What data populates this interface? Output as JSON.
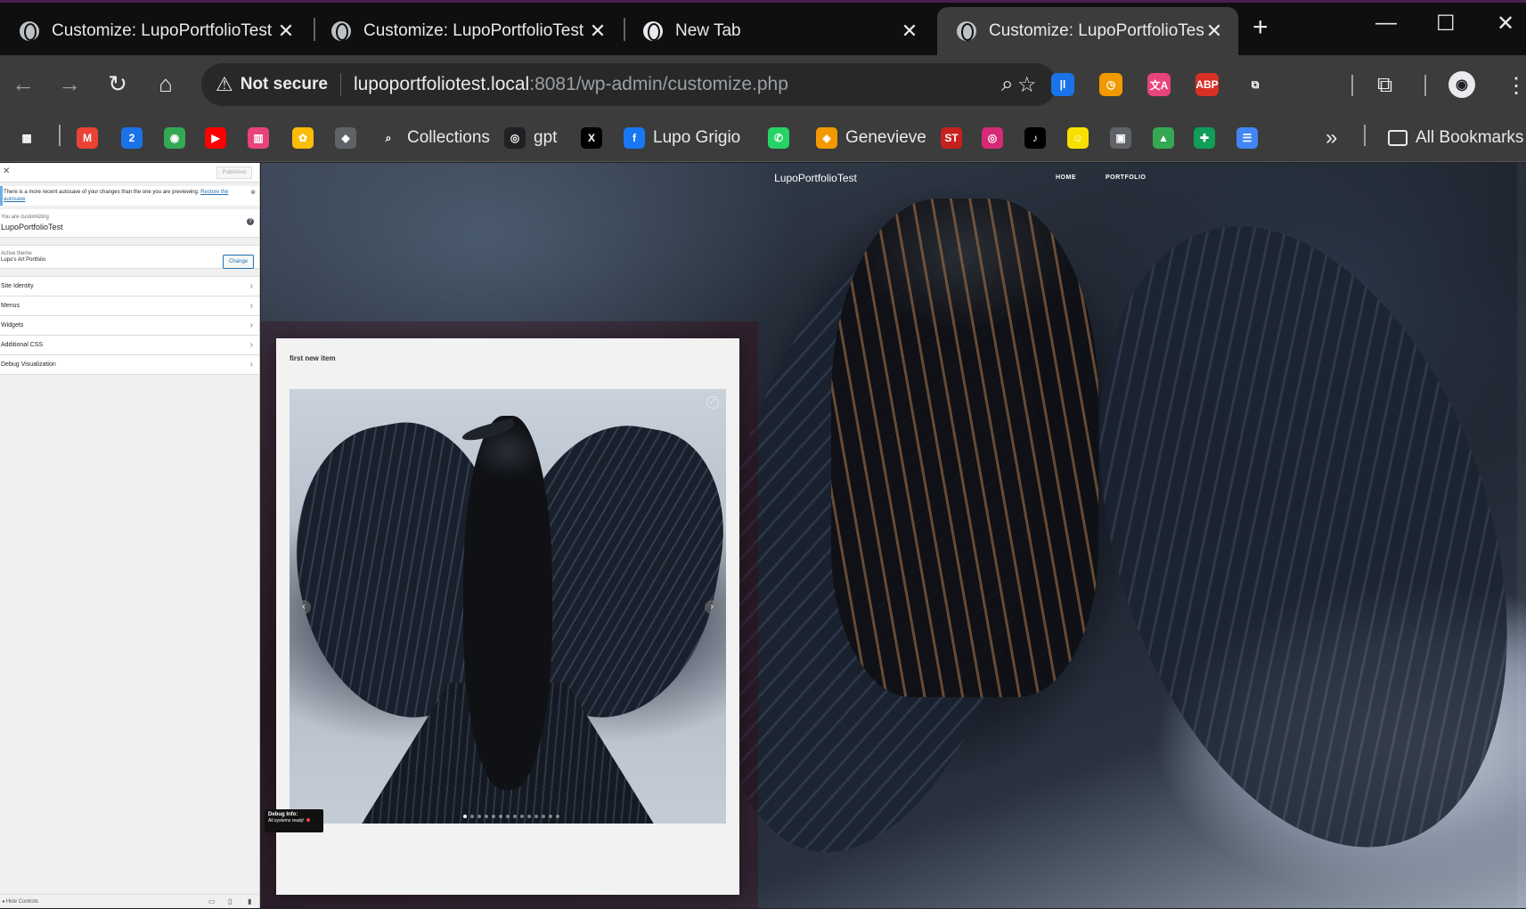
{
  "browser": {
    "tabs": [
      {
        "title": "Customize: LupoPortfolioTest",
        "icon": "globe-icon",
        "active": false
      },
      {
        "title": "Customize: LupoPortfolioTest",
        "icon": "globe-icon",
        "active": false
      },
      {
        "title": "New Tab",
        "icon": "chrome-icon",
        "active": false
      },
      {
        "title": "Customize: LupoPortfolioTest",
        "icon": "globe-icon",
        "active": true
      }
    ],
    "close_glyph": "✕",
    "new_tab_glyph": "+",
    "window_controls": {
      "minimize": "—",
      "maximize": "☐",
      "close": "✕"
    },
    "address": {
      "security_label": "Not secure",
      "host": "lupoportfoliotest.local",
      "path": ":8081/wp-admin/customize.php"
    },
    "extensions": [
      {
        "name": "extension-bar-icon",
        "text": "|l",
        "color": "#1a73e8"
      },
      {
        "name": "extension-clock-icon",
        "text": "◷",
        "color": "#f29900"
      },
      {
        "name": "extension-translate-icon",
        "text": "文A",
        "color": "#e8437b"
      },
      {
        "name": "extension-adblock-icon",
        "text": "ABP",
        "color": "#d93025"
      },
      {
        "name": "extension-puzzle-icon",
        "text": "⧉",
        "color": "#3c3c3c"
      }
    ],
    "bookmarks": [
      {
        "label": "",
        "icon": "apps-grid-icon",
        "glyph": "▦",
        "color": "#3c3c3c"
      },
      {
        "label": "",
        "icon": "gmail-icon",
        "glyph": "M",
        "color": "#ea4335"
      },
      {
        "label": "",
        "icon": "calendar-icon",
        "glyph": "2",
        "color": "#1a73e8"
      },
      {
        "label": "",
        "icon": "maps-icon",
        "glyph": "◉",
        "color": "#34a853"
      },
      {
        "label": "",
        "icon": "youtube-icon",
        "glyph": "▶",
        "color": "#ff0000"
      },
      {
        "label": "",
        "icon": "app-icon",
        "glyph": "▥",
        "color": "#e8437b"
      },
      {
        "label": "",
        "icon": "photos-icon",
        "glyph": "✿",
        "color": "#fbbc04"
      },
      {
        "label": "",
        "icon": "bird-icon",
        "glyph": "◆",
        "color": "#5f6368"
      },
      {
        "label": "Collections",
        "icon": "search-icon",
        "glyph": "⌕",
        "color": "#3c3c3c"
      },
      {
        "label": "gpt",
        "icon": "openai-icon",
        "glyph": "◎",
        "color": "#202124"
      },
      {
        "label": "",
        "icon": "x-icon",
        "glyph": "X",
        "color": "#000000"
      },
      {
        "label": "Lupo Grigio",
        "icon": "facebook-icon",
        "glyph": "f",
        "color": "#1877f2"
      },
      {
        "label": "",
        "icon": "whatsapp-icon",
        "glyph": "✆",
        "color": "#25d366"
      },
      {
        "label": "Genevieve",
        "icon": "layers-icon",
        "glyph": "◈",
        "color": "#f29900"
      },
      {
        "label": "",
        "icon": "st-icon",
        "glyph": "ST",
        "color": "#c5221f"
      },
      {
        "label": "",
        "icon": "instagram-icon",
        "glyph": "◎",
        "color": "#d62976"
      },
      {
        "label": "",
        "icon": "tiktok-icon",
        "glyph": "♪",
        "color": "#000000"
      },
      {
        "label": "",
        "icon": "snapchat-icon",
        "glyph": "☺",
        "color": "#f7e000"
      },
      {
        "label": "",
        "icon": "film-icon",
        "glyph": "▣",
        "color": "#5f6368"
      },
      {
        "label": "",
        "icon": "drive-icon",
        "glyph": "▲",
        "color": "#34a853"
      },
      {
        "label": "",
        "icon": "sheets-icon",
        "glyph": "✚",
        "color": "#0f9d58"
      },
      {
        "label": "",
        "icon": "docs-icon",
        "glyph": "☰",
        "color": "#4285f4"
      }
    ],
    "bookmarks_overflow": "»",
    "all_bookmarks": "All Bookmarks"
  },
  "customizer": {
    "published_label": "Published",
    "notice_text": "There is a more recent autosave of your changes than the one you are previewing.",
    "notice_link": "Restore the autosave",
    "customizing_label": "You are customizing",
    "site_name": "LupoPortfolioTest",
    "theme_label": "Active theme",
    "theme_name": "Lupo's Art Portfolio",
    "change_button": "Change",
    "sections": [
      "Site Identity",
      "Menus",
      "Widgets",
      "Additional CSS",
      "Debug Visualization"
    ],
    "hide_controls": "Hide Controls"
  },
  "preview": {
    "site_title": "LupoPortfolioTest",
    "nav": [
      "HOME",
      "PORTFOLIO"
    ],
    "item_title": "first new item",
    "slider": {
      "total": 14,
      "current": 1
    },
    "debug": {
      "title": "Debug Info:",
      "status": "All systems ready!"
    }
  }
}
